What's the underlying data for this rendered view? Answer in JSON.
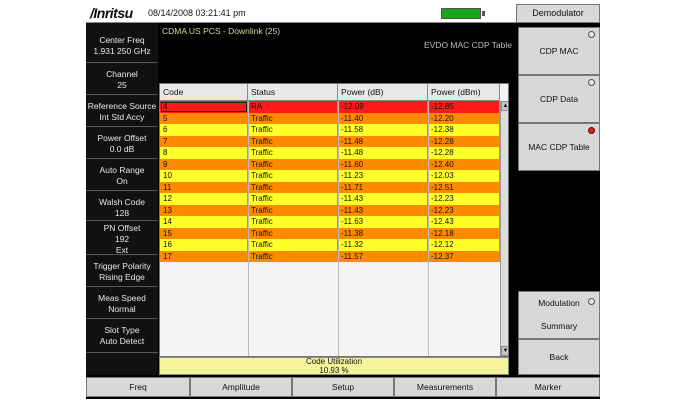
{
  "header": {
    "brand": "/Inritsu",
    "datetime": "08/14/2008 03:21:41 pm"
  },
  "panel_title": "Demodulator",
  "display": {
    "mode_label": "CDMA US PCS - Downlink (25)",
    "table_title": "EVDO MAC CDP Table"
  },
  "left_panel": [
    {
      "label": "Center Freq",
      "value": "1.931 250 GHz"
    },
    {
      "label": "Channel",
      "value": "25"
    },
    {
      "label": "Reference Source",
      "value": "Int Std Accy"
    },
    {
      "label": "Power Offset",
      "value": "0.0 dB"
    },
    {
      "label": "Auto Range",
      "value": "On"
    },
    {
      "label": "Walsh Code",
      "value": "128"
    },
    {
      "label": "PN Offset",
      "value": "192",
      "extra": "Ext"
    },
    {
      "label": "Trigger Polarity",
      "value": "Rising Edge"
    },
    {
      "label": "Meas Speed",
      "value": "Normal"
    },
    {
      "label": "Slot Type",
      "value": "Auto Detect"
    }
  ],
  "table": {
    "columns": [
      "Code",
      "Status",
      "Power (dB)",
      "Power (dBm)"
    ],
    "rows": [
      {
        "code": "4",
        "status": "RA",
        "power_db": "-12.09",
        "power_dbm": "-12.85",
        "color": "#ff1a1a"
      },
      {
        "code": "5",
        "status": "Traffic",
        "power_db": "-11.40",
        "power_dbm": "-12.20",
        "color": "#ff8a00"
      },
      {
        "code": "6",
        "status": "Traffic",
        "power_db": "-11.58",
        "power_dbm": "-12.38",
        "color": "#ffff2a"
      },
      {
        "code": "7",
        "status": "Traffic",
        "power_db": "-11.48",
        "power_dbm": "-12.28",
        "color": "#ff8a00"
      },
      {
        "code": "8",
        "status": "Traffic",
        "power_db": "-11.48",
        "power_dbm": "-12.28",
        "color": "#ffff2a"
      },
      {
        "code": "9",
        "status": "Traffic",
        "power_db": "-11.60",
        "power_dbm": "-12.40",
        "color": "#ff8a00"
      },
      {
        "code": "10",
        "status": "Traffic",
        "power_db": "-11.23",
        "power_dbm": "-12.03",
        "color": "#ffff2a"
      },
      {
        "code": "11",
        "status": "Traffic",
        "power_db": "-11.71",
        "power_dbm": "-12.51",
        "color": "#ff8a00"
      },
      {
        "code": "12",
        "status": "Traffic",
        "power_db": "-11.43",
        "power_dbm": "-12.23",
        "color": "#ffff2a"
      },
      {
        "code": "13",
        "status": "Traffic",
        "power_db": "-11.43",
        "power_dbm": "-12.23",
        "color": "#ff8a00"
      },
      {
        "code": "14",
        "status": "Traffic",
        "power_db": "-11.63",
        "power_dbm": "-12.43",
        "color": "#ffff2a"
      },
      {
        "code": "15",
        "status": "Traffic",
        "power_db": "-11.38",
        "power_dbm": "-12.18",
        "color": "#ff8a00"
      },
      {
        "code": "16",
        "status": "Traffic",
        "power_db": "-11.32",
        "power_dbm": "-12.12",
        "color": "#ffff2a"
      },
      {
        "code": "17",
        "status": "Traffic",
        "power_db": "-11.57",
        "power_dbm": "-12.37",
        "color": "#ff8a00"
      }
    ]
  },
  "utilization": {
    "label": "Code Utilization",
    "value": "10.93 %"
  },
  "softkeys": {
    "cdp_mac": "CDP MAC",
    "cdp_data": "CDP Data",
    "mac_cdp_table": "MAC CDP Table",
    "modulation": "Modulation",
    "summary": "Summary",
    "back": "Back",
    "back_hint": "<--"
  },
  "bottom_tabs": [
    "Freq",
    "Amplitude",
    "Setup",
    "Measurements",
    "Marker"
  ],
  "icons": {
    "scroll_up": "▲",
    "scroll_down": "▼"
  },
  "colors": {
    "battery": "#1aa51a",
    "active_indicator": "#d42020"
  }
}
